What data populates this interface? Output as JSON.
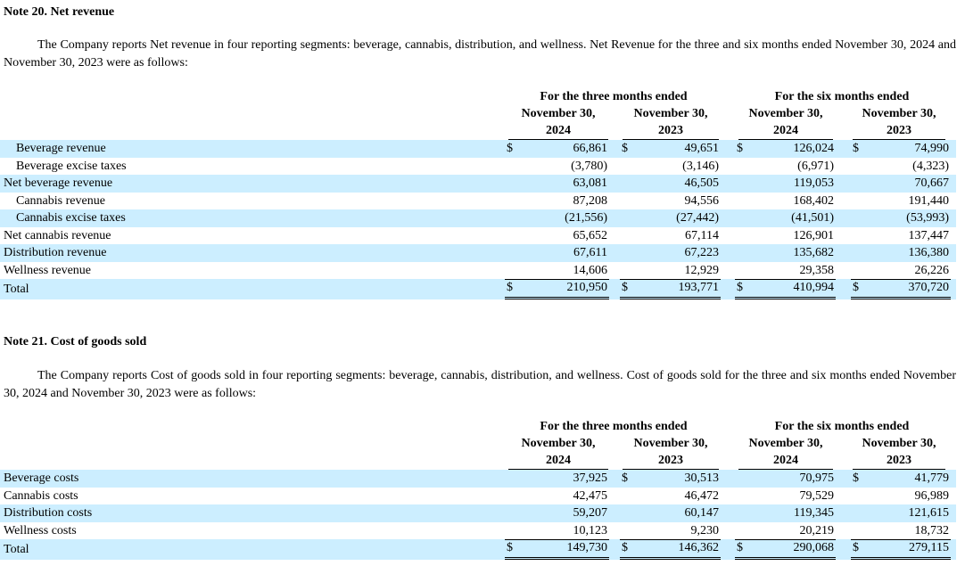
{
  "note20": {
    "heading": "Note 20. Net revenue",
    "paragraph": "The Company reports Net revenue in four reporting segments: beverage, cannabis, distribution, and wellness. Net Revenue for the three and six months ended November 30, 2024 and November 30, 2023 were as follows:",
    "group_three": "For the three months ended",
    "group_six": "For the six months ended",
    "col_headers": [
      {
        "line1": "November 30,",
        "year": "2024"
      },
      {
        "line1": "November 30,",
        "year": "2023"
      },
      {
        "line1": "November 30,",
        "year": "2024"
      },
      {
        "line1": "November 30,",
        "year": "2023"
      }
    ],
    "rows": [
      {
        "label": "Beverage revenue",
        "values": [
          "66,861",
          "49,651",
          "126,024",
          "74,990"
        ],
        "dollar": [
          "$",
          "$",
          "$",
          "$"
        ]
      },
      {
        "label": "Beverage excise taxes",
        "values": [
          "(3,780)",
          "(3,146)",
          "(6,971)",
          "(4,323)"
        ],
        "dollar": [
          "",
          "",
          "",
          ""
        ]
      },
      {
        "label": "Net beverage revenue",
        "values": [
          "63,081",
          "46,505",
          "119,053",
          "70,667"
        ],
        "dollar": [
          "",
          "",
          "",
          ""
        ]
      },
      {
        "label": "Cannabis revenue",
        "values": [
          "87,208",
          "94,556",
          "168,402",
          "191,440"
        ],
        "dollar": [
          "",
          "",
          "",
          ""
        ]
      },
      {
        "label": "Cannabis excise taxes",
        "values": [
          "(21,556)",
          "(27,442)",
          "(41,501)",
          "(53,993)"
        ],
        "dollar": [
          "",
          "",
          "",
          ""
        ]
      },
      {
        "label": "Net cannabis revenue",
        "values": [
          "65,652",
          "67,114",
          "126,901",
          "137,447"
        ],
        "dollar": [
          "",
          "",
          "",
          ""
        ]
      },
      {
        "label": "Distribution revenue",
        "values": [
          "67,611",
          "67,223",
          "135,682",
          "136,380"
        ],
        "dollar": [
          "",
          "",
          "",
          ""
        ]
      },
      {
        "label": "Wellness revenue",
        "values": [
          "14,606",
          "12,929",
          "29,358",
          "26,226"
        ],
        "dollar": [
          "",
          "",
          "",
          ""
        ]
      },
      {
        "label": "Total",
        "values": [
          "210,950",
          "193,771",
          "410,994",
          "370,720"
        ],
        "dollar": [
          "$",
          "$",
          "$",
          "$"
        ]
      }
    ]
  },
  "note21": {
    "heading": "Note 21. Cost of goods sold",
    "paragraph": "The Company reports Cost of goods sold in four reporting segments: beverage, cannabis, distribution, and wellness. Cost of goods sold for the three and six months ended November 30, 2024 and November 30, 2023 were as follows:",
    "group_three": "For the three months ended",
    "group_six": "For the six months ended",
    "col_headers": [
      {
        "line1": "November 30,",
        "year": "2024"
      },
      {
        "line1": "November 30,",
        "year": "2023"
      },
      {
        "line1": "November 30,",
        "year": "2024"
      },
      {
        "line1": "November 30,",
        "year": "2023"
      }
    ],
    "rows": [
      {
        "label": "Beverage costs",
        "values": [
          "37,925",
          "30,513",
          "70,975",
          "41,779"
        ],
        "dollar": [
          "",
          "$",
          "",
          "$"
        ]
      },
      {
        "label": "Cannabis costs",
        "values": [
          "42,475",
          "46,472",
          "79,529",
          "96,989"
        ],
        "dollar": [
          "",
          "",
          "",
          ""
        ]
      },
      {
        "label": "Distribution costs",
        "values": [
          "59,207",
          "60,147",
          "119,345",
          "121,615"
        ],
        "dollar": [
          "",
          "",
          "",
          ""
        ]
      },
      {
        "label": "Wellness costs",
        "values": [
          "10,123",
          "9,230",
          "20,219",
          "18,732"
        ],
        "dollar": [
          "",
          "",
          "",
          ""
        ]
      },
      {
        "label": "Total",
        "values": [
          "149,730",
          "146,362",
          "290,068",
          "279,115"
        ],
        "dollar": [
          "$",
          "$",
          "$",
          "$"
        ]
      }
    ]
  }
}
